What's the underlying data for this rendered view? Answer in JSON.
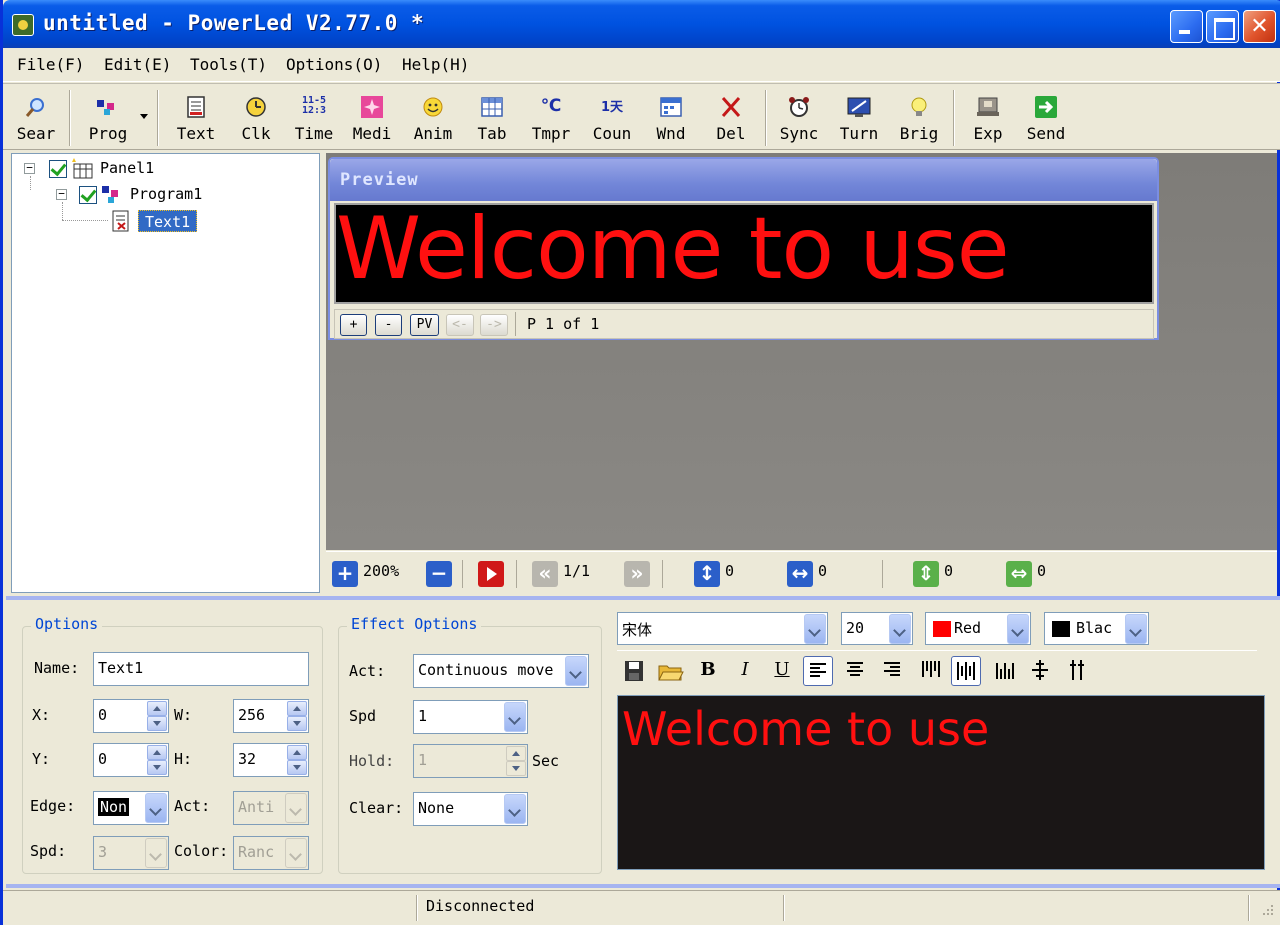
{
  "window": {
    "title": "untitled - PowerLed V2.77.0 *"
  },
  "menu": [
    "File(F)",
    "Edit(E)",
    "Tools(T)",
    "Options(O)",
    "Help(H)"
  ],
  "toolbar": {
    "sear": "Sear",
    "prog": "Prog",
    "text": "Text",
    "clk": "Clk",
    "time": "Time",
    "medi": "Medi",
    "anim": "Anim",
    "tab": "Tab",
    "tmpr": "Tmpr",
    "coun": "Coun",
    "wnd": "Wnd",
    "del": "Del",
    "sync": "Sync",
    "turn": "Turn",
    "brig": "Brig",
    "exp": "Exp",
    "send": "Send",
    "time_icon_top": "11-5",
    "time_icon_bottom": "12:3",
    "tmpr_icon": "℃",
    "coun_icon": "1天"
  },
  "tree": {
    "panel": "Panel1",
    "program": "Program1",
    "text": "Text1"
  },
  "preview": {
    "title": "Preview",
    "led_text": "Welcome to use",
    "led_color": "#ff1010",
    "nav_plus": "+",
    "nav_minus": "-",
    "nav_pv": "PV",
    "nav_prev": "<-",
    "nav_next": "->",
    "page_info": "P 1 of 1"
  },
  "workstrip": {
    "zoom": "200%",
    "page": "1/1",
    "v_move": "0",
    "h_move": "0",
    "v_size": "0",
    "h_size": "0"
  },
  "options": {
    "title": "Options",
    "name_label": "Name:",
    "name_value": "Text1",
    "x_label": "X:",
    "x_value": "0",
    "w_label": "W:",
    "w_value": "256",
    "y_label": "Y:",
    "y_value": "0",
    "h_label": "H:",
    "h_value": "32",
    "edge_label": "Edge:",
    "edge_value": "Non",
    "act_label": "Act:",
    "act_value": "Anti",
    "spd_label": "Spd:",
    "spd_value": "3",
    "color_label": "Color:",
    "color_value": "Ranc"
  },
  "effect": {
    "title": "Effect Options",
    "act_label": "Act:",
    "act_value": "Continuous move",
    "spd_label": "Spd",
    "spd_value": "1",
    "hold_label": "Hold:",
    "hold_value": "1",
    "hold_unit": "Sec",
    "clear_label": "Clear:",
    "clear_value": "None"
  },
  "format": {
    "font": "宋体",
    "size": "20",
    "fg_color_name": "Red",
    "fg_color": "#ff0000",
    "bg_color_name": "Blac",
    "bg_color": "#000000",
    "bold": "B",
    "italic": "I",
    "underline": "U"
  },
  "editor": {
    "text": "Welcome to use",
    "color": "#ff1010"
  },
  "status": {
    "connection": "Disconnected"
  }
}
